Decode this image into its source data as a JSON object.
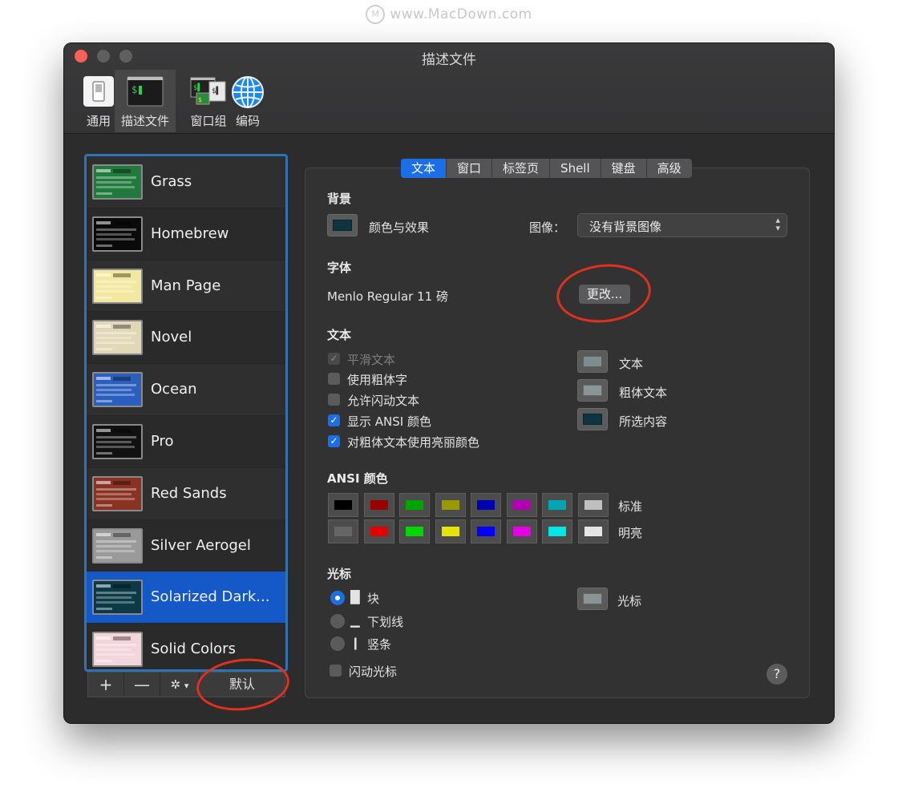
{
  "watermark": "www.MacDown.com",
  "window": {
    "title": "描述文件"
  },
  "toolbar": {
    "items": [
      {
        "label": "通用"
      },
      {
        "label": "描述文件"
      },
      {
        "label": "窗口组"
      },
      {
        "label": "编码"
      }
    ]
  },
  "profiles": {
    "items": [
      {
        "name": "Grass",
        "thumb_color": "#1f7a3b"
      },
      {
        "name": "Homebrew",
        "thumb_color": "#0a0a0a"
      },
      {
        "name": "Man Page",
        "thumb_color": "#f2e8a0"
      },
      {
        "name": "Novel",
        "thumb_color": "#e2d8b8"
      },
      {
        "name": "Ocean",
        "thumb_color": "#2b5fbf"
      },
      {
        "name": "Pro",
        "thumb_color": "#111111"
      },
      {
        "name": "Red Sands",
        "thumb_color": "#8a3322"
      },
      {
        "name": "Silver Aerogel",
        "thumb_color": "#9a9a9a"
      },
      {
        "name": "Solarized Dark...",
        "thumb_color": "#0b3a46"
      },
      {
        "name": "Solid Colors",
        "thumb_color": "#f2d6dc"
      }
    ],
    "selected": "Solarized Dark...",
    "buttons": {
      "add": "+",
      "remove": "—",
      "default": "默认"
    }
  },
  "tabs": [
    "文本",
    "窗口",
    "标签页",
    "Shell",
    "键盘",
    "高级"
  ],
  "active_tab": "文本",
  "background": {
    "title": "背景",
    "color_effects_label": "颜色与效果",
    "color": "#0e3440",
    "image_label": "图像：",
    "image_value": "没有背景图像"
  },
  "font": {
    "title": "字体",
    "value": "Menlo Regular 11 磅",
    "change_button": "更改..."
  },
  "text": {
    "title": "文本",
    "options": [
      {
        "label": "平滑文本",
        "checked": true,
        "disabled": true
      },
      {
        "label": "使用粗体字",
        "checked": false,
        "disabled": false
      },
      {
        "label": "允许闪动文本",
        "checked": false,
        "disabled": false
      },
      {
        "label": "显示 ANSI 颜色",
        "checked": true,
        "disabled": false
      },
      {
        "label": "对粗体文本使用亮丽颜色",
        "checked": true,
        "disabled": false
      }
    ],
    "colors": [
      {
        "label": "文本",
        "color": "#7d8c8c"
      },
      {
        "label": "粗体文本",
        "color": "#8a9696"
      },
      {
        "label": "所选内容",
        "color": "#0e3440"
      }
    ]
  },
  "ansi": {
    "title": "ANSI 颜色",
    "normal_label": "标准",
    "bright_label": "明亮",
    "normal": [
      "#000000",
      "#990000",
      "#00a600",
      "#999900",
      "#0000b2",
      "#b200b2",
      "#00a6b2",
      "#bfbfbf"
    ],
    "bright": [
      "#666666",
      "#e50000",
      "#00d900",
      "#e5e500",
      "#0000ff",
      "#e500e5",
      "#00e5e5",
      "#e5e5e5"
    ]
  },
  "cursor": {
    "title": "光标",
    "styles": [
      {
        "label": "块",
        "glyph": "█",
        "selected": true
      },
      {
        "label": "下划线",
        "glyph": "▁",
        "selected": false
      },
      {
        "label": "竖条",
        "glyph": "❙",
        "selected": false
      }
    ],
    "blink_label": "闪动光标",
    "blink_checked": false,
    "color_label": "光标",
    "color": "#8a9494"
  },
  "help": "?"
}
